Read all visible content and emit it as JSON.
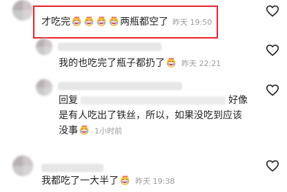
{
  "comments": [
    {
      "text_prefix": "才吃完",
      "emoji_count": 4,
      "text_suffix": "两瓶都空了",
      "time": "昨天 19:50"
    },
    {
      "text": "我的也吃完了瓶子都扔了",
      "time": "昨天 22:21"
    },
    {
      "reply_label": "回复",
      "line1_end": "好像",
      "line2": "是有人吃出了铁丝，所以，如果没吃到应该",
      "line3": "没事",
      "time": "1小时前"
    },
    {
      "text": "我都吃了一大半了",
      "time": "昨天 19:38"
    }
  ],
  "colors": {
    "highlight": "#e8202a",
    "meta": "#9a9a9a"
  },
  "icons": [
    "heart-outline-icon",
    "crying-laugh-emoji"
  ]
}
